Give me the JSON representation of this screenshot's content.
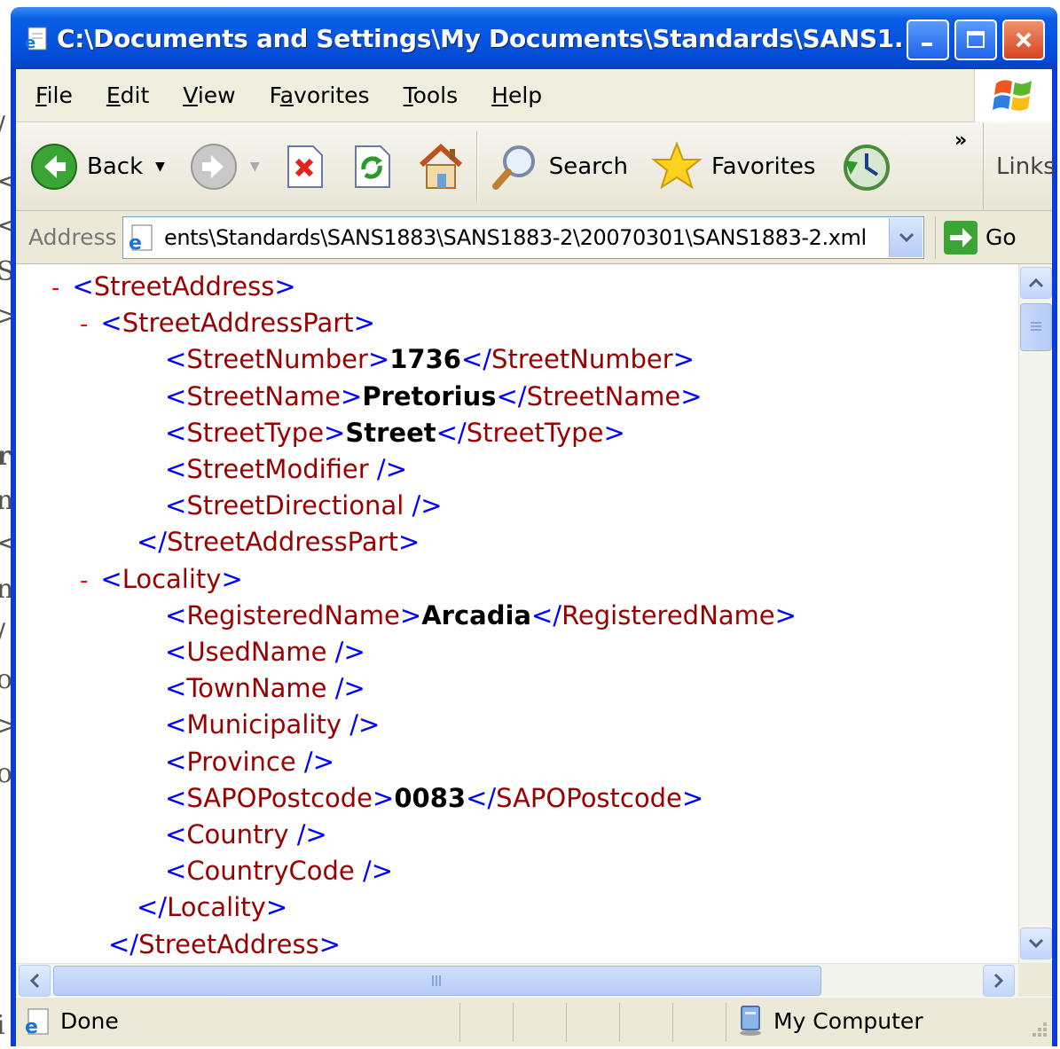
{
  "window": {
    "title": "C:\\Documents and Settings\\My Documents\\Standards\\SANS1..."
  },
  "menu": {
    "items": [
      {
        "label": "File",
        "accel": "F",
        "rest": "ile"
      },
      {
        "label": "Edit",
        "accel": "E",
        "rest": "dit"
      },
      {
        "label": "View",
        "accel": "V",
        "rest": "iew"
      },
      {
        "label": "Favorites",
        "pre": "F",
        "accel": "a",
        "rest": "vorites"
      },
      {
        "label": "Tools",
        "accel": "T",
        "rest": "ools"
      },
      {
        "label": "Help",
        "accel": "H",
        "rest": "elp"
      }
    ]
  },
  "toolbar": {
    "back_label": "Back",
    "search_label": "Search",
    "favorites_label": "Favorites",
    "links_label": "Links",
    "chevron": "»"
  },
  "address": {
    "label": "Address",
    "value": "ents\\Standards\\SANS1883\\SANS1883-2\\20070301\\SANS1883-2.xml",
    "go_label": "Go"
  },
  "xml": {
    "lines": [
      {
        "minus": "-",
        "open": "<",
        "tag": "StreetAddress",
        "close": ">"
      },
      {
        "minus": "-",
        "open": "<",
        "tag": "StreetAddressPart",
        "close": ">"
      },
      {
        "open": "<",
        "tag": "StreetNumber",
        "close": ">",
        "value": "1736",
        "end_open": "</",
        "end_tag": "StreetNumber",
        "end_close": ">"
      },
      {
        "open": "<",
        "tag": "StreetName",
        "close": ">",
        "value": "Pretorius",
        "end_open": "</",
        "end_tag": "StreetName",
        "end_close": ">"
      },
      {
        "open": "<",
        "tag": "StreetType",
        "close": ">",
        "value": "Street",
        "end_open": "</",
        "end_tag": "StreetType",
        "end_close": ">"
      },
      {
        "open": "<",
        "tag": "StreetModifier",
        "close": " />"
      },
      {
        "open": "<",
        "tag": "StreetDirectional",
        "close": " />"
      },
      {
        "open": "</",
        "tag": "StreetAddressPart",
        "close": ">"
      },
      {
        "minus": "-",
        "open": "<",
        "tag": "Locality",
        "close": ">"
      },
      {
        "open": "<",
        "tag": "RegisteredName",
        "close": ">",
        "value": "Arcadia",
        "end_open": "</",
        "end_tag": "RegisteredName",
        "end_close": ">"
      },
      {
        "open": "<",
        "tag": "UsedName",
        "close": " />"
      },
      {
        "open": "<",
        "tag": "TownName",
        "close": " />"
      },
      {
        "open": "<",
        "tag": "Municipality",
        "close": " />"
      },
      {
        "open": "<",
        "tag": "Province",
        "close": " />"
      },
      {
        "open": "<",
        "tag": "SAPOPostcode",
        "close": ">",
        "value": "0083",
        "end_open": "</",
        "end_tag": "SAPOPostcode",
        "end_close": ">"
      },
      {
        "open": "<",
        "tag": "Country",
        "close": " />"
      },
      {
        "open": "<",
        "tag": "CountryCode",
        "close": " />"
      },
      {
        "open": "</",
        "tag": "Locality",
        "close": ">"
      },
      {
        "open": "</",
        "tag": "StreetAddress",
        "close": ">"
      }
    ]
  },
  "status": {
    "text": "Done",
    "zone": "My Computer"
  },
  "background_fragments": [
    "/",
    "<",
    "<",
    "S",
    ">",
    "r",
    "n",
    "<",
    "n",
    "/",
    "o",
    ">",
    "o",
    "i"
  ]
}
